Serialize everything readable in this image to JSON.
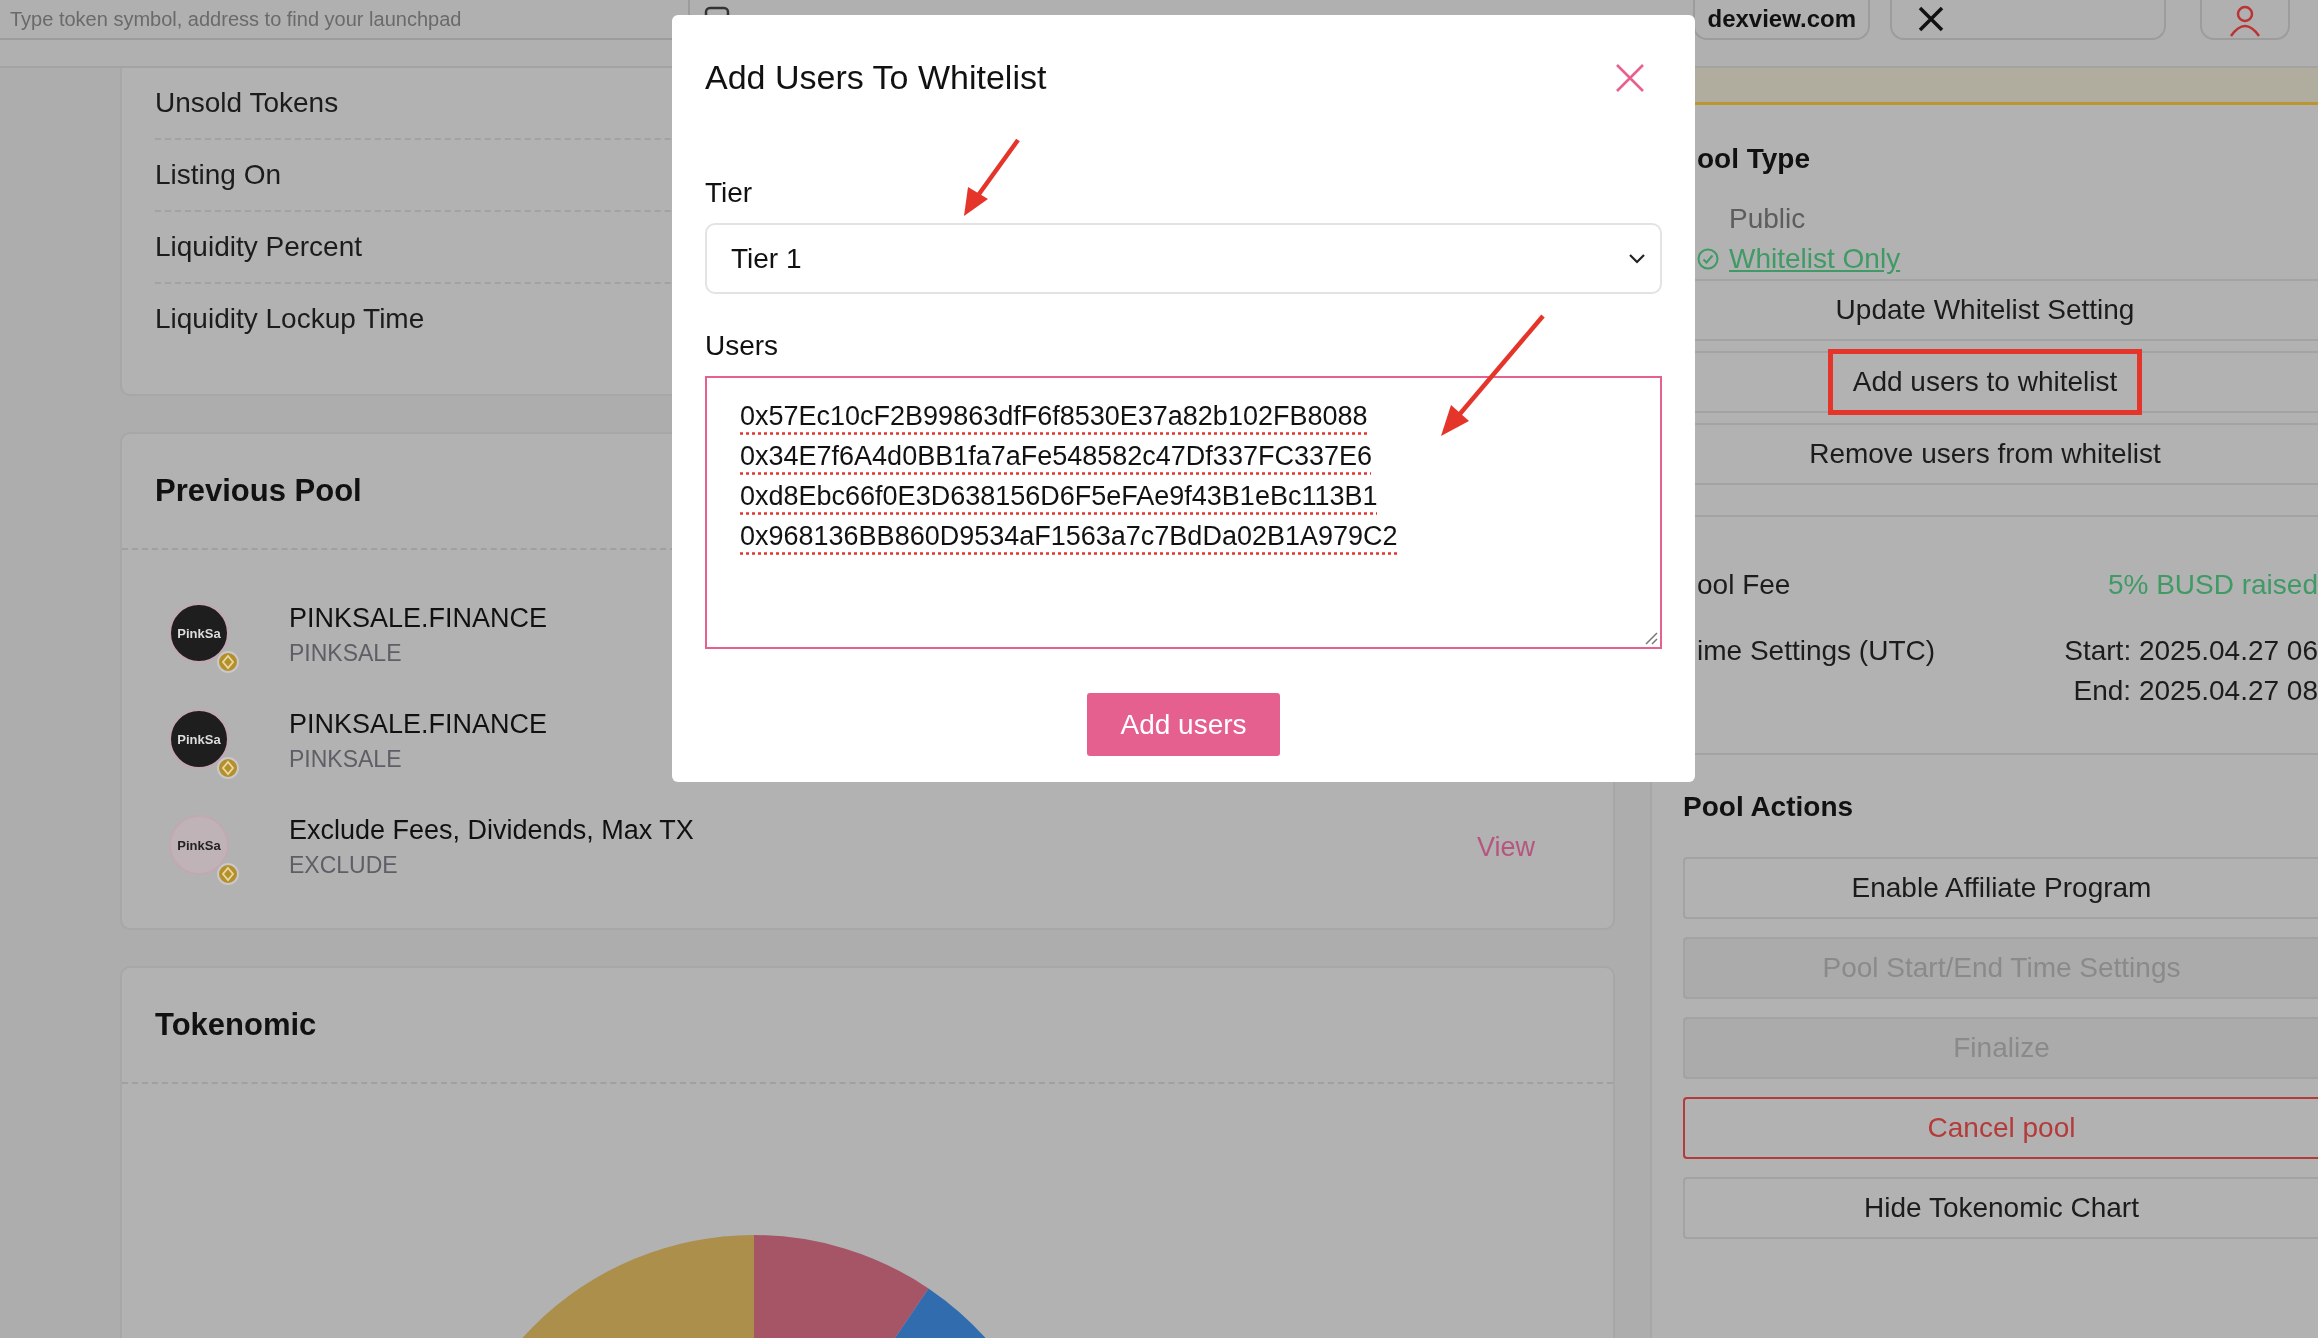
{
  "top_bar": {
    "search": {
      "placeholder": "Type token symbol, address to find your launchpad"
    },
    "site_link": "dexview.com"
  },
  "info_rows": [
    "Unsold Tokens",
    "Listing On",
    "Liquidity Percent",
    "Liquidity Lockup Time"
  ],
  "previous_pool": {
    "title": "Previous Pool",
    "items": [
      {
        "name": "PINKSALE.FINANCE",
        "symbol": "PINKSALE",
        "logo_text": "PinkSa",
        "logo_dark": true
      },
      {
        "name": "PINKSALE.FINANCE",
        "symbol": "PINKSALE",
        "logo_text": "PinkSa",
        "logo_dark": true
      },
      {
        "name": "Exclude Fees, Dividends, Max TX",
        "symbol": "EXCLUDE",
        "logo_text": "PinkSa",
        "logo_dark": false,
        "link": "View"
      }
    ]
  },
  "tokenomic": {
    "title": "Tokenomic"
  },
  "pool_type": {
    "title": "ool Type",
    "options": [
      {
        "label": "Public",
        "selected": false
      },
      {
        "label": "Whitelist Only",
        "selected": true
      }
    ],
    "actions": [
      {
        "label": "Update Whitelist Setting",
        "highlighted": false
      },
      {
        "label": "Add users to whitelist",
        "highlighted": true
      },
      {
        "label": "Remove users from whitelist",
        "highlighted": false
      }
    ]
  },
  "pool_fee": {
    "label": "ool Fee",
    "value": "5% BUSD raised"
  },
  "time_settings": {
    "label": "ime Settings (UTC)",
    "start": "Start: 2025.04.27 06",
    "end": "End: 2025.04.27 08"
  },
  "pool_actions": {
    "title": "Pool Actions",
    "buttons": [
      {
        "label": "Enable Affiliate Program",
        "kind": "normal"
      },
      {
        "label": "Pool Start/End Time Settings",
        "kind": "disabled"
      },
      {
        "label": "Finalize",
        "kind": "disabled"
      },
      {
        "label": "Cancel pool",
        "kind": "danger"
      },
      {
        "label": "Hide Tokenomic Chart",
        "kind": "normal"
      }
    ]
  },
  "modal": {
    "title": "Add Users To Whitelist",
    "tier_label": "Tier",
    "tier_value": "Tier 1",
    "users_label": "Users",
    "users": [
      "0x57Ec10cF2B99863dfF6f8530E37a82b102FB8088",
      "0x34E7f6A4d0BB1fa7aFe548582c47Df337FC337E6",
      "0xd8Ebc66f0E3D638156D6F5eFAe9f43B1eBc113B1",
      "0x968136BB860D9534aF1563a7c7BdDa02B1A979C2"
    ],
    "submit": "Add users"
  }
}
